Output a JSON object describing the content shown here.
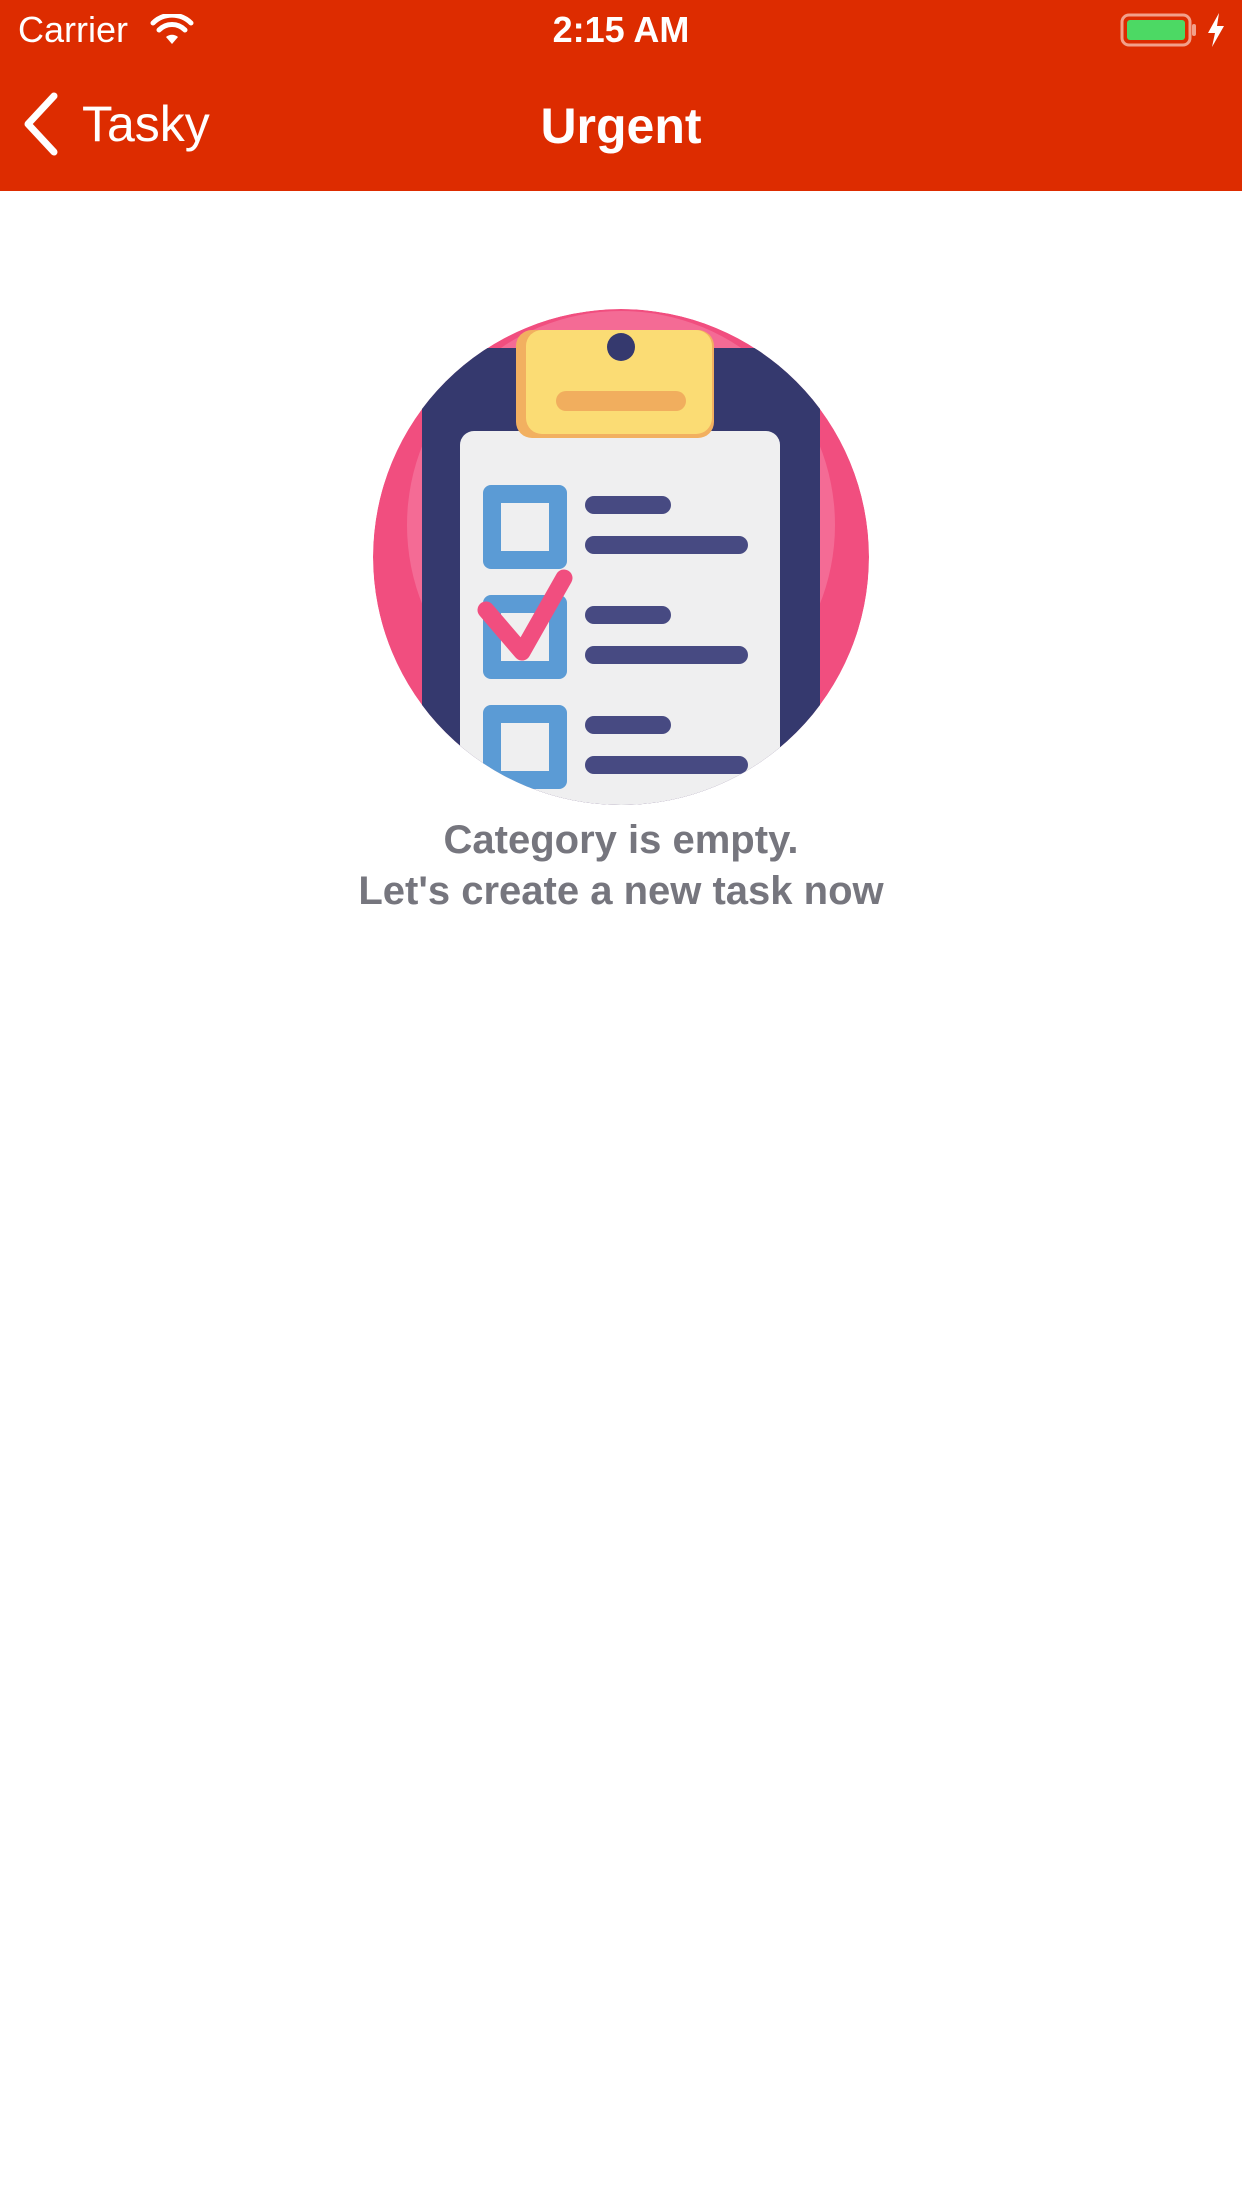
{
  "status_bar": {
    "carrier": "Carrier",
    "time": "2:15 AM",
    "wifi_icon": "wifi-icon",
    "battery_icon": "battery-icon",
    "charging_icon": "charging-bolt-icon"
  },
  "nav": {
    "back_label": "Tasky",
    "title": "Urgent",
    "back_icon": "chevron-left-icon"
  },
  "empty_state": {
    "illustration_icon": "clipboard-checklist-icon",
    "line1": "Category is empty.",
    "line2": "Let's create a new task now"
  },
  "colors": {
    "header": "#dd2c00",
    "empty_text": "#76767e",
    "battery_fill": "#4cd964"
  }
}
